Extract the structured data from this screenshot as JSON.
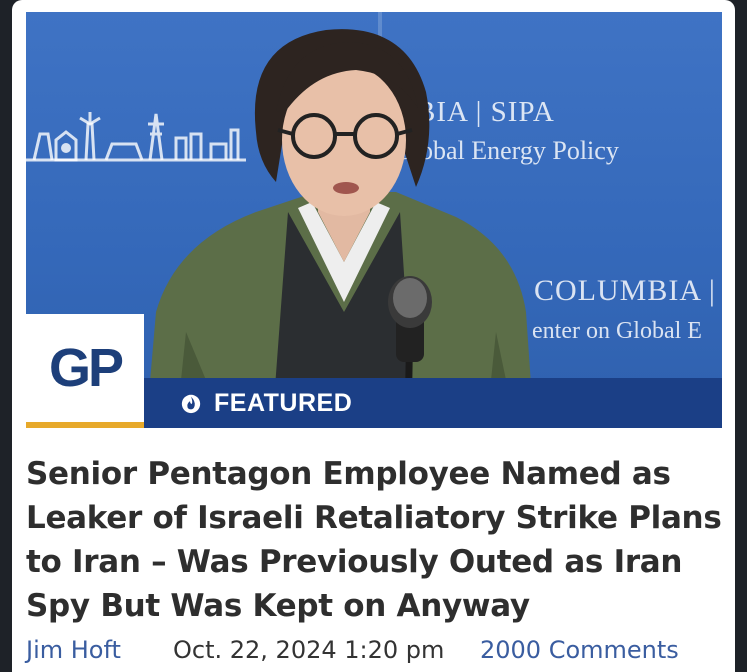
{
  "article": {
    "featured_label": "FEATURED",
    "logo_text": "GP",
    "headline": "Senior Pentagon Employee Named as Leaker of Israeli Retaliatory Strike Plans to Iran – Was Previously Outed as Iran Spy But Was Kept on Anyway",
    "author": "Jim Hoft",
    "date": "Oct. 22, 2024 1:20 pm",
    "comments": "2000 Comments"
  },
  "image_backdrop": {
    "line1": "BIA | SIPA",
    "line2": "Global Energy Policy",
    "line3": "COLUMBIA | S",
    "line4": "enter on Global E"
  },
  "colors": {
    "backdrop_blue": "#3468b9",
    "featured_bar": "#1b3f86",
    "logo_navy": "#1d3f7a",
    "logo_accent": "#e7a92a",
    "link_blue": "#3a5da0",
    "headline_text": "#2e2e2e"
  },
  "icons": {
    "featured": "fire-icon",
    "skyline": "energy-skyline-icon"
  }
}
